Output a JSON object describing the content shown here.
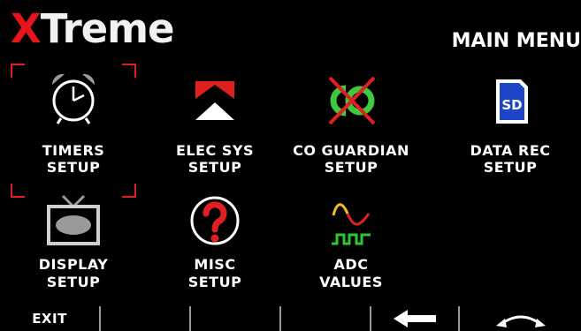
{
  "header": {
    "brand_x": "X",
    "brand_rest": "Treme",
    "title": "MAIN MENU"
  },
  "colors": {
    "background": "#000000",
    "brand_red": "#e8141b",
    "selection": "#e02020",
    "text": "#ffffff"
  },
  "menu": {
    "items": [
      {
        "line1": "TIMERS",
        "line2": "SETUP",
        "icon": "alarm-clock-icon",
        "selected": true
      },
      {
        "line1": "ELEC SYS",
        "line2": "SETUP",
        "icon": "elec-sys-arrows-icon",
        "selected": false
      },
      {
        "line1": "CO GUARDIAN",
        "line2": "SETUP",
        "icon": "co-guardian-icon",
        "selected": false
      },
      {
        "line1": "DATA REC",
        "line2": "SETUP",
        "icon": "sd-card-icon",
        "selected": false
      },
      {
        "line1": "DISPLAY",
        "line2": "SETUP",
        "icon": "tv-display-icon",
        "selected": false
      },
      {
        "line1": "MISC",
        "line2": "SETUP",
        "icon": "question-mark-icon",
        "selected": false
      },
      {
        "line1": "ADC",
        "line2": "VALUES",
        "icon": "waveform-icon",
        "selected": false
      }
    ],
    "sd_text": "SD"
  },
  "softkeys": [
    {
      "label": "EXIT",
      "icon": ""
    },
    {
      "label": "",
      "icon": ""
    },
    {
      "label": "",
      "icon": ""
    },
    {
      "label": "",
      "icon": ""
    },
    {
      "label": "",
      "icon": "left-arrow-icon"
    },
    {
      "label": "",
      "icon": "rotate-knob-icon"
    }
  ]
}
